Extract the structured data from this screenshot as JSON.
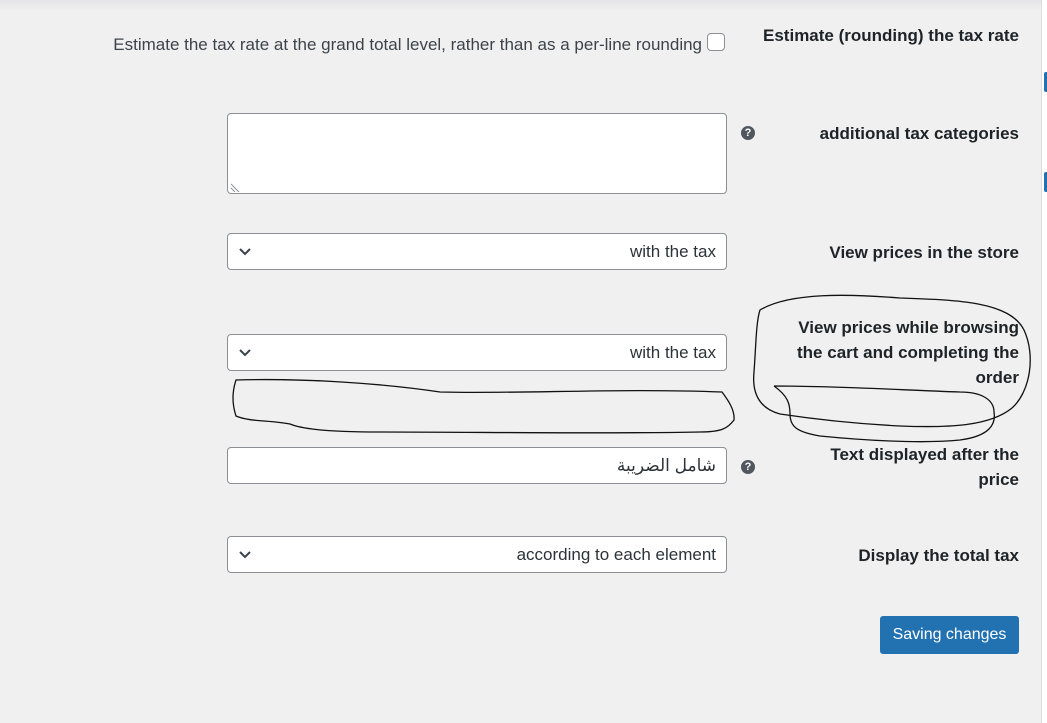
{
  "settings": {
    "rounding": {
      "label": "Estimate (rounding) the tax rate",
      "description": "Estimate the tax rate at the grand total level, rather than as a per-line rounding",
      "checked": false
    },
    "additional_tax_categories": {
      "label": "additional tax categories",
      "value": "",
      "help_icon": "question-circle-icon"
    },
    "prices_in_store": {
      "label": "View prices in the store",
      "selected": "with the tax"
    },
    "prices_in_cart": {
      "label": "View prices while browsing the cart and completing the order",
      "selected": "with the tax"
    },
    "price_suffix": {
      "label": "Text displayed after the price",
      "value": "شامل الضريبة",
      "help_icon": "question-circle-icon"
    },
    "total_tax_display": {
      "label": "Display the total tax",
      "selected": "according to each element"
    }
  },
  "actions": {
    "save_label": "Saving changes"
  },
  "colors": {
    "background": "#f0f0f1",
    "accent": "#2271b1",
    "text": "#1d2327"
  }
}
